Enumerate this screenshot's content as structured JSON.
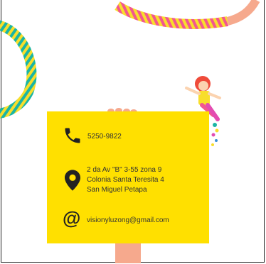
{
  "contact": {
    "phone": "5250-9822",
    "address_line1": "2 da Av \"B\" 3-55 zona 9",
    "address_line2": "Colonia Santa Teresita 4",
    "address_line3": "San Miguel Petapa",
    "email": "visionyluzong@gmail.com"
  },
  "icons": {
    "phone": "phone-icon",
    "location": "location-pin-icon",
    "email": "at-sign-icon"
  },
  "colors": {
    "card": "#ffe000",
    "icon": "#222222",
    "hoop_pink": "#f2578f",
    "hoop_yellow": "#f8de2b",
    "hoop_teal": "#1ab5a5",
    "hoop_peach": "#f6a98d"
  }
}
